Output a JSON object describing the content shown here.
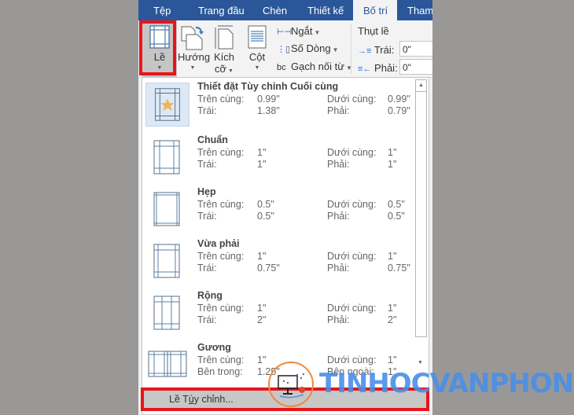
{
  "tabs": [
    {
      "label": "Tệp",
      "active": false
    },
    {
      "label": "Trang đầu",
      "active": false
    },
    {
      "label": "Chèn",
      "active": false
    },
    {
      "label": "Thiết kế",
      "active": false
    },
    {
      "label": "Bố trí",
      "active": true
    },
    {
      "label": "Tham",
      "active": false
    }
  ],
  "ribbon": {
    "margins": {
      "label": "Lề",
      "icon": "margins-icon"
    },
    "orientation": {
      "label": "Hướng",
      "icon": "orientation-icon"
    },
    "size": {
      "label1": "Kích",
      "label2": "cỡ",
      "icon": "page-size-icon"
    },
    "columns": {
      "label": "Cột",
      "icon": "columns-icon"
    },
    "breaks": {
      "label": "Ngắt",
      "icon": "breaks-icon"
    },
    "line_numbers": {
      "label": "Số Dòng",
      "icon": "line-numbers-icon"
    },
    "hyphenation": {
      "label": "Gạch nối từ",
      "icon": "hyphenation-icon"
    },
    "indent": {
      "title": "Thụt lề",
      "left_label": "Trái:",
      "left_value": "0\"",
      "right_label": "Phải:",
      "right_value": "0\""
    }
  },
  "margins_menu": {
    "items": [
      {
        "title": "Thiết đặt Tùy chỉnh Cuối cùng",
        "selected": true,
        "icon": "custom-star",
        "k1": "Trên cùng:",
        "v1": "0.99\"",
        "k2": "Dưới cùng:",
        "v2": "0.99\"",
        "k3": "Trái:",
        "v3": "1.38\"",
        "k4": "Phải:",
        "v4": "0.79\""
      },
      {
        "title": "Chuẩn",
        "selected": false,
        "icon": "normal",
        "k1": "Trên cùng:",
        "v1": "1\"",
        "k2": "Dưới cùng:",
        "v2": "1\"",
        "k3": "Trái:",
        "v3": "1\"",
        "k4": "Phải:",
        "v4": "1\""
      },
      {
        "title": "Hẹp",
        "selected": false,
        "icon": "narrow",
        "k1": "Trên cùng:",
        "v1": "0.5\"",
        "k2": "Dưới cùng:",
        "v2": "0.5\"",
        "k3": "Trái:",
        "v3": "0.5\"",
        "k4": "Phải:",
        "v4": "0.5\""
      },
      {
        "title": "Vừa phải",
        "selected": false,
        "icon": "moderate",
        "k1": "Trên cùng:",
        "v1": "1\"",
        "k2": "Dưới cùng:",
        "v2": "1\"",
        "k3": "Trái:",
        "v3": "0.75\"",
        "k4": "Phải:",
        "v4": "0.75\""
      },
      {
        "title": "Rộng",
        "selected": false,
        "icon": "wide",
        "k1": "Trên cùng:",
        "v1": "1\"",
        "k2": "Dưới cùng:",
        "v2": "1\"",
        "k3": "Trái:",
        "v3": "2\"",
        "k4": "Phải:",
        "v4": "2\""
      },
      {
        "title": "Gương",
        "selected": false,
        "icon": "mirrored",
        "k1": "Trên cùng:",
        "v1": "1\"",
        "k2": "Dưới cùng:",
        "v2": "1\"",
        "k3": "Bên trong:",
        "v3": "1.25\"",
        "k4": "Bên ngoài:",
        "v4": "1\""
      }
    ],
    "custom_margins": {
      "label_pre": "Lề T",
      "label_underlined": "ù",
      "label_post": "y chỉnh..."
    }
  },
  "watermark": {
    "text": "TINHOCVANPHONG"
  },
  "colors": {
    "accent": "#2b579a",
    "highlight": "#e8141b",
    "background": "#999897",
    "watermark": "#4a8fe8"
  }
}
